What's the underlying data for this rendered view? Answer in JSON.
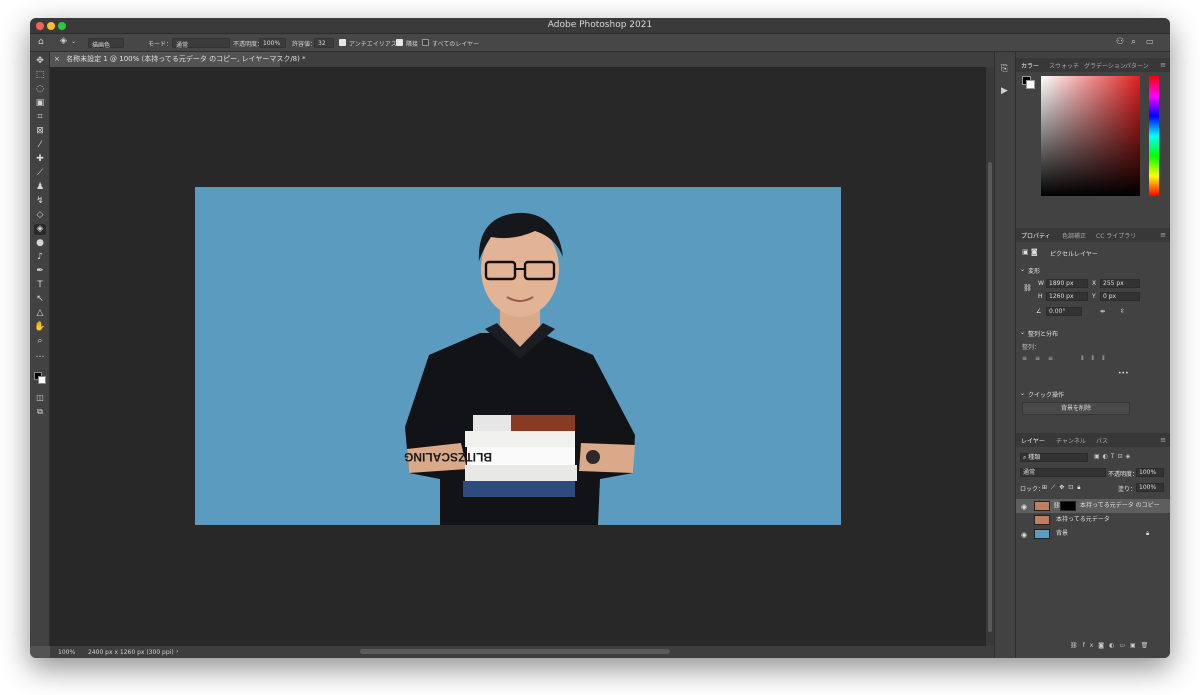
{
  "window": {
    "title": "Adobe Photoshop 2021"
  },
  "options_bar": {
    "fill_source": "描画色",
    "mode_label": "モード：",
    "mode_value": "通常",
    "opacity_label": "不透明度：",
    "opacity_value": "100%",
    "tolerance_label": "許容値：",
    "tolerance_value": "32",
    "antialias_label": "アンチエイリアス",
    "contiguous_label": "隣接",
    "all_layers_label": "すべてのレイヤー"
  },
  "document": {
    "tab_title": "名称未設定 1 @ 100% (本持ってる元データ のコピー, レイヤーマスク/8) *"
  },
  "status": {
    "zoom": "100%",
    "doc_info": "2400 px x 1260 px (300 ppi)",
    "arrow": "›"
  },
  "color_panel": {
    "tabs": [
      "カラー",
      "スウォッチ",
      "グラデーション",
      "パターン"
    ]
  },
  "properties_panel": {
    "tabs": [
      "プロパティ",
      "色調補正",
      "CC ライブラリ"
    ],
    "layer_type": "ピクセルレイヤー",
    "transform_title": "変形",
    "w_label": "W",
    "w_value": "1890 px",
    "h_label": "H",
    "h_value": "1260 px",
    "x_label": "X",
    "x_value": "255 px",
    "y_label": "Y",
    "y_value": "0 px",
    "angle_value": "0.00°",
    "align_title": "整列と分布",
    "align_label": "整列：",
    "quick_title": "クイック操作",
    "remove_bg_button": "背景を削除"
  },
  "layers_panel": {
    "tabs": [
      "レイヤー",
      "チャンネル",
      "パス"
    ],
    "filter_kind": "種類",
    "blend_mode": "通常",
    "opacity_label": "不透明度：",
    "opacity_value": "100%",
    "lock_label": "ロック：",
    "fill_label": "塗り：",
    "fill_value": "100%",
    "layers": [
      {
        "name": "本持ってる元データ のコピー",
        "visible": true
      },
      {
        "name": "本持ってる元データ",
        "visible": false
      },
      {
        "name": "背景",
        "visible": true
      }
    ]
  },
  "book_spine_text": "BLITZSCALING",
  "colors": {
    "canvas_bg": "#5b9bbf",
    "workspace": "#282828",
    "panel": "#424242"
  }
}
